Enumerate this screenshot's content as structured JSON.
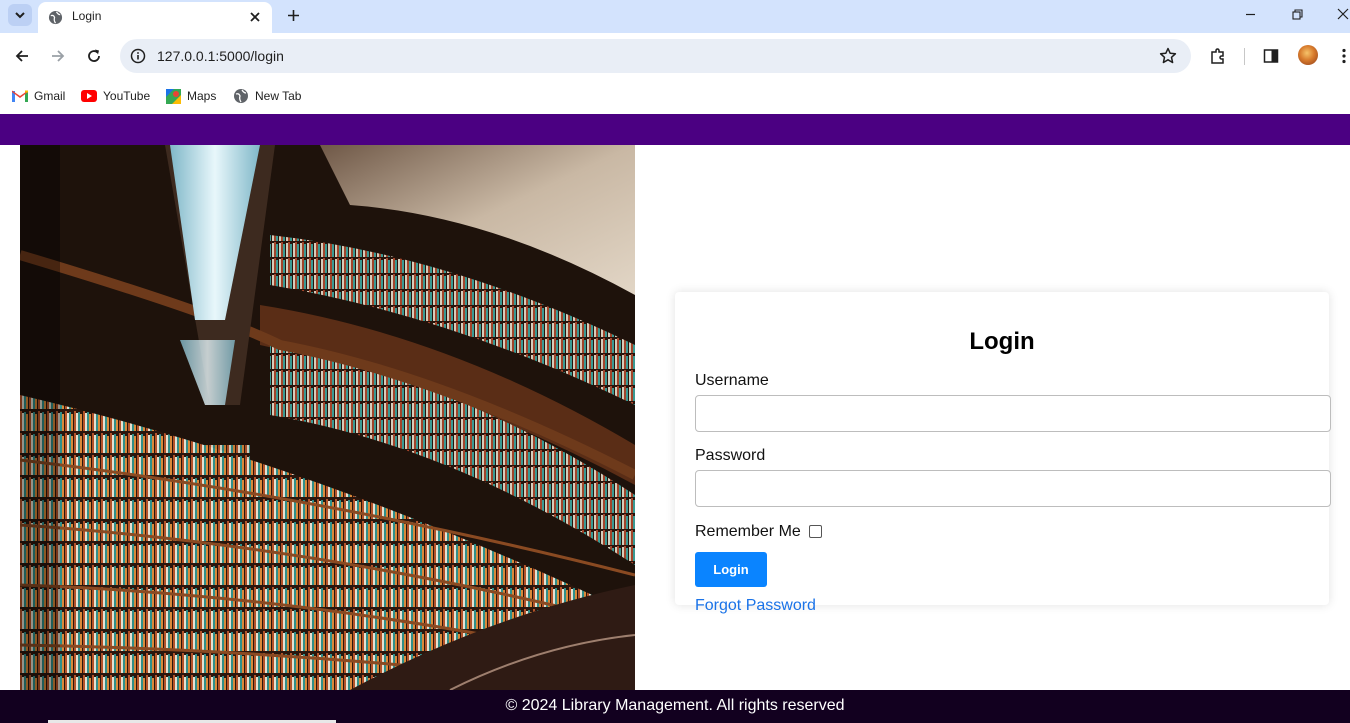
{
  "browser": {
    "tab": {
      "title": "Login"
    },
    "address_bar": {
      "url": "127.0.0.1:5000/login"
    },
    "bookmarks": [
      {
        "label": "Gmail",
        "icon": "gmail-icon"
      },
      {
        "label": "YouTube",
        "icon": "youtube-icon"
      },
      {
        "label": "Maps",
        "icon": "maps-icon"
      },
      {
        "label": "New Tab",
        "icon": "globe-icon"
      }
    ]
  },
  "colors": {
    "header": "#4b0082",
    "footer": "#12001f",
    "primary_button": "#0a84ff",
    "link": "#1a73e8"
  },
  "login_form": {
    "title": "Login",
    "username_label": "Username",
    "username_value": "",
    "password_label": "Password",
    "password_value": "",
    "remember_label": "Remember Me",
    "remember_checked": false,
    "submit_label": "Login",
    "forgot_link": "Forgot Password"
  },
  "footer": {
    "text": "© 2024 Library Management. All rights reserved"
  }
}
